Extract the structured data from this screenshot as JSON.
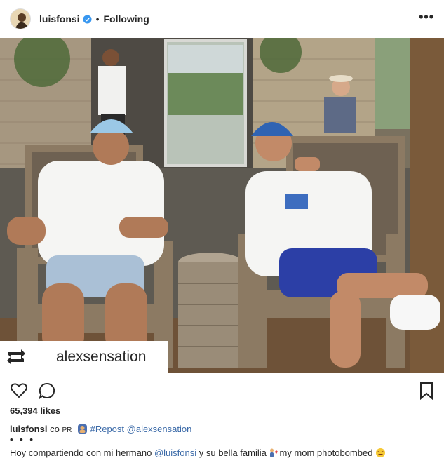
{
  "post": {
    "username": "luisfonsi",
    "separator": "•",
    "following_label": "Following",
    "more_label": "•••",
    "repost_name": "alexsensation",
    "likes": "65,394 likes",
    "caption_user": "luisfonsi",
    "caption_prefix": "co",
    "caption_pr": "PR",
    "hashtag": "#Repost",
    "mention": "@alexsensation",
    "more_dots": "• • •",
    "line_start": "Hoy compartiendo con mi hermano",
    "line_mention": "@luisfonsi",
    "line_mid": "y su bella familia",
    "line_end": "my mom photobombed"
  },
  "icons": {
    "verified": "verified-badge-icon",
    "like": "heart-icon",
    "comment": "comment-icon",
    "save": "bookmark-icon",
    "repost": "repost-icon"
  },
  "colors": {
    "verified": "#3897f0",
    "link": "#3b6aa8"
  }
}
